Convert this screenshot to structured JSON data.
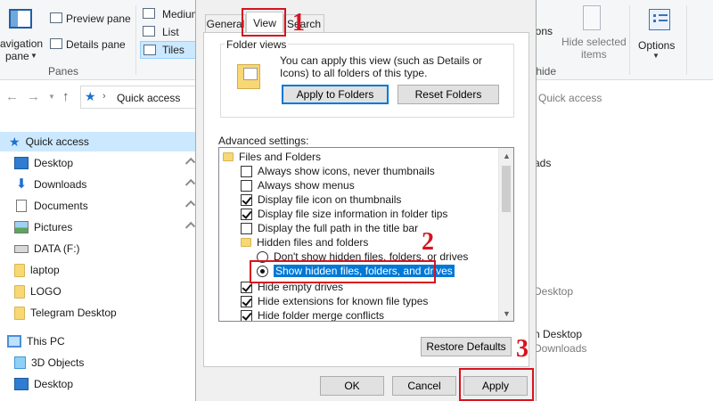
{
  "ribbon": {
    "layout_group": {
      "items": [
        "Medium",
        "List",
        "Tiles"
      ],
      "selected": "Tiles"
    },
    "panes_group": {
      "navigation_pane_line1": "avigation",
      "navigation_pane_line2": "pane",
      "preview_pane": "Preview pane",
      "details_pane": "Details pane",
      "label": "Panes"
    },
    "right_partial": {
      "options_fragment": "ions",
      "hide_fragment": "/hide",
      "hide_selected_line1": "Hide selected",
      "hide_selected_line2": "items",
      "options": "Options"
    }
  },
  "address": {
    "location": "Quick access",
    "right_fragment": "n Quick access"
  },
  "nav": {
    "items": [
      {
        "label": "Quick access",
        "icon": "star-icon"
      },
      {
        "label": "Desktop",
        "icon": "desktop-icon",
        "pinned": true
      },
      {
        "label": "Downloads",
        "icon": "download-icon",
        "pinned": true
      },
      {
        "label": "Documents",
        "icon": "document-icon",
        "pinned": true
      },
      {
        "label": "Pictures",
        "icon": "picture-icon",
        "pinned": true
      },
      {
        "label": "DATA (F:)",
        "icon": "drive-icon"
      },
      {
        "label": "laptop",
        "icon": "folder-icon"
      },
      {
        "label": "LOGO",
        "icon": "folder-icon"
      },
      {
        "label": "Telegram Desktop",
        "icon": "folder-icon"
      },
      {
        "label": "This PC",
        "icon": "computer-icon"
      },
      {
        "label": "3D Objects",
        "icon": "cube-icon"
      },
      {
        "label": "Desktop",
        "icon": "desktop-icon"
      }
    ]
  },
  "right_content": {
    "line1": "ads",
    "line2": "Desktop",
    "line3": "n Desktop",
    "line4": "Downloads"
  },
  "dialog": {
    "tabs": [
      "General",
      "View",
      "Search"
    ],
    "active_tab": "View",
    "folder_views": {
      "label": "Folder views",
      "description": "You can apply this view (such as Details or Icons) to all folders of this type.",
      "apply_button": "Apply to Folders",
      "reset_button": "Reset Folders"
    },
    "advanced_label": "Advanced settings:",
    "advanced": [
      {
        "type": "folder",
        "label": "Files and Folders"
      },
      {
        "type": "checkbox",
        "label": "Always show icons, never thumbnails",
        "checked": false
      },
      {
        "type": "checkbox",
        "label": "Always show menus",
        "checked": false
      },
      {
        "type": "checkbox",
        "label": "Display file icon on thumbnails",
        "checked": true
      },
      {
        "type": "checkbox",
        "label": "Display file size information in folder tips",
        "checked": true
      },
      {
        "type": "checkbox",
        "label": "Display the full path in the title bar",
        "checked": false
      },
      {
        "type": "folder",
        "label": "Hidden files and folders"
      },
      {
        "type": "radio",
        "label": "Don't show hidden files, folders, or drives",
        "checked": false
      },
      {
        "type": "radio",
        "label": "Show hidden files, folders, and drives",
        "checked": true
      },
      {
        "type": "checkbox",
        "label": "Hide empty drives",
        "checked": true
      },
      {
        "type": "checkbox",
        "label": "Hide extensions for known file types",
        "checked": true
      },
      {
        "type": "checkbox",
        "label": "Hide folder merge conflicts",
        "checked": true
      }
    ],
    "restore_button": "Restore Defaults",
    "ok_button": "OK",
    "cancel_button": "Cancel",
    "apply_button": "Apply"
  },
  "annotations": {
    "step1": "1",
    "step2": "2",
    "step3": "3",
    "color": "#d7131f"
  },
  "colors": {
    "selection": "#cce8ff",
    "accent": "#0078d7",
    "dialog_bg": "#f0f0f0"
  }
}
